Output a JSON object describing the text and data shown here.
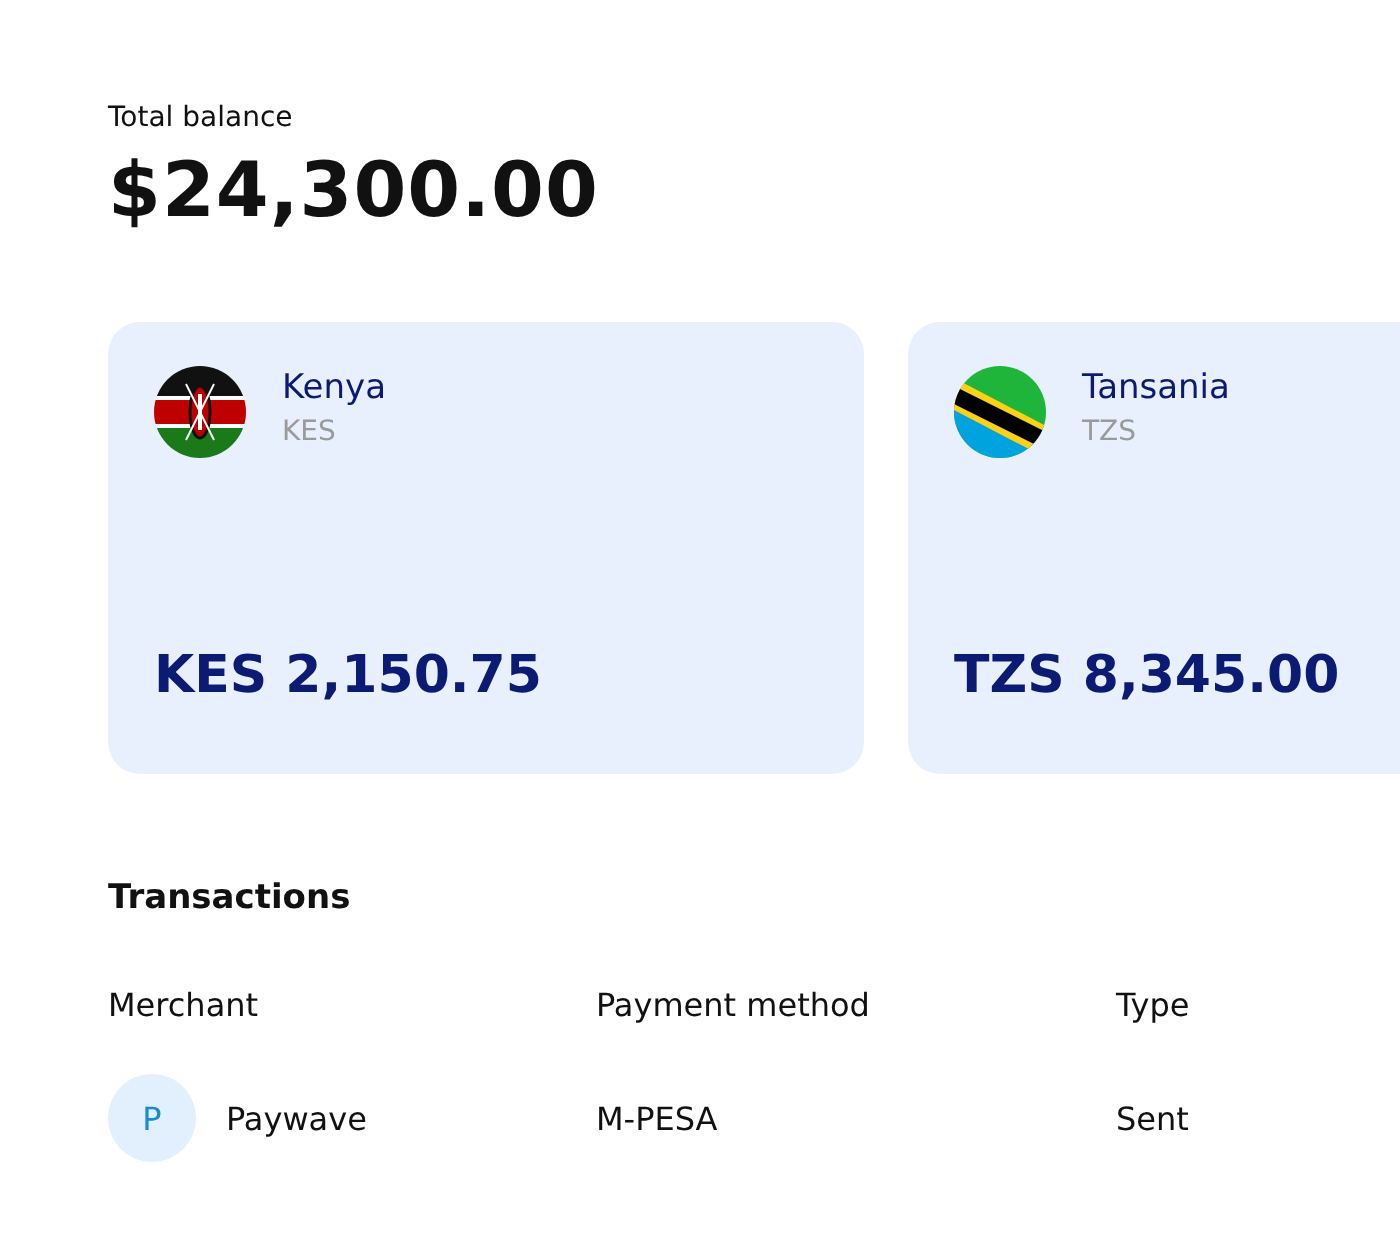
{
  "balance": {
    "label": "Total balance",
    "amount": "$24,300.00"
  },
  "accounts": [
    {
      "kind": "kenya",
      "country": "Kenya",
      "code": "KES",
      "amount": "KES 2,150.75"
    },
    {
      "kind": "tanzania",
      "country": "Tansania",
      "code": "TZS",
      "amount": "TZS 8,345.00"
    }
  ],
  "transactions": {
    "title": "Transactions",
    "columns": [
      "Merchant",
      "Payment method",
      "Type"
    ],
    "rows": [
      {
        "avatar": "P",
        "merchant": "Paywave",
        "method": "M-PESA",
        "type": "Sent"
      }
    ]
  }
}
